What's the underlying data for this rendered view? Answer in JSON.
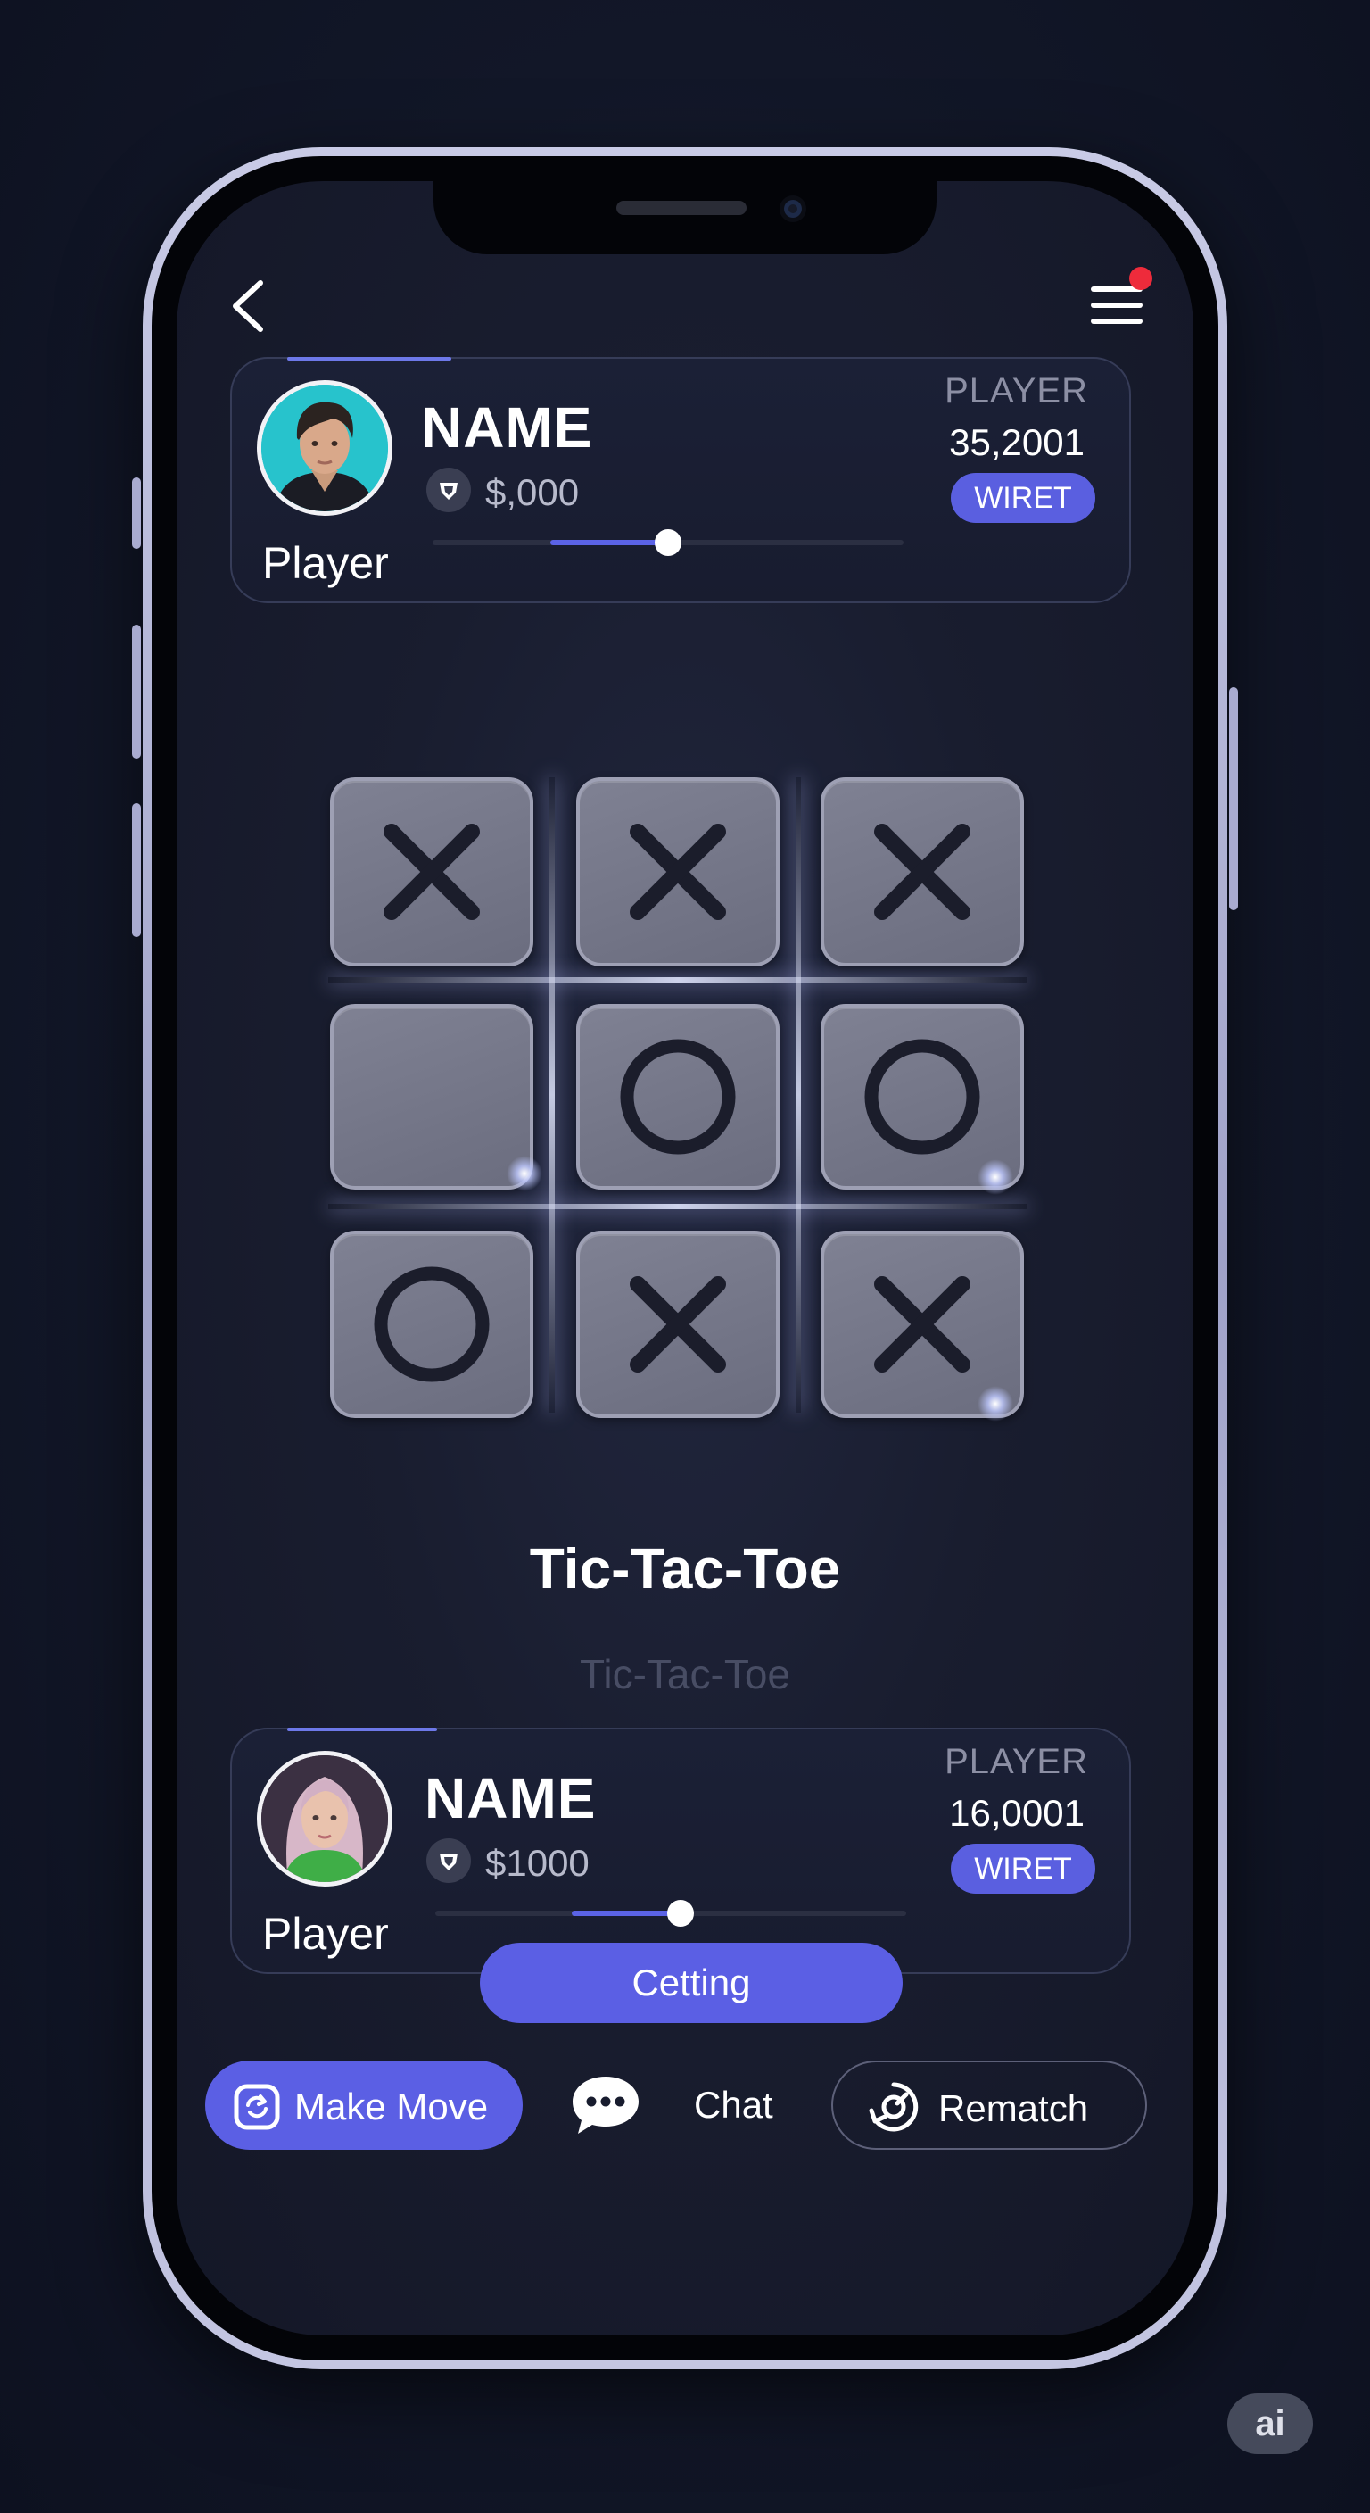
{
  "top_player": {
    "name": "NAME",
    "coins": "$,000",
    "label": "Player",
    "stat_label": "PLAYER",
    "stat_value": "35,2001",
    "badge": "WIRET",
    "slider_fill_start": 0.25,
    "slider_value": 0.5
  },
  "bottom_player": {
    "name": "NAME",
    "coins": "$1000",
    "label": "Player",
    "stat_label": "PLAYER",
    "stat_value": "16,0001",
    "badge": "WIRET",
    "slider_fill_start": 0.29,
    "slider_value": 0.52
  },
  "board": {
    "cells": [
      "X",
      "X",
      "X",
      "",
      "O",
      "O",
      "O",
      "X",
      "X"
    ]
  },
  "game": {
    "title": "Tic-Tac-Toe",
    "subtitle": "Tic-Tac-Toe"
  },
  "actions": {
    "primary": "Cetting",
    "make_move": "Make Move",
    "chat": "Chat",
    "rematch": "Rematch"
  },
  "watermark": "ai",
  "colors": {
    "accent": "#5b5fe4",
    "notification": "#ee2b3b",
    "background": "#141727"
  }
}
